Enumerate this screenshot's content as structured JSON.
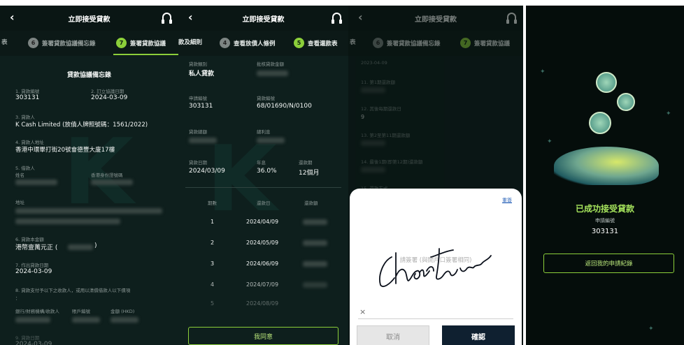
{
  "screen1": {
    "title": "立即接受貸款",
    "steps": [
      {
        "num": "",
        "label": "表"
      },
      {
        "num": "6",
        "label": "簽署貸款協議備忘錄"
      },
      {
        "num": "7",
        "label": "簽署貸款協議"
      }
    ],
    "heading": "貸款協議備忘錄",
    "f1_label": "1. 貸款編號",
    "f1_value": "303131",
    "f2_label": "2. 訂立協議日期",
    "f2_value": "2024-03-09",
    "f3_label": "3. 貸款人",
    "f3_value": "K Cash Limited (放債人牌照號碼：1561/2022)",
    "f4_label": "4. 貸款人地址",
    "f4_value": "香港中環畢打街20號會德豐大廈17樓",
    "f5_label": "5. 借款人",
    "f5_name": "姓名",
    "f5_id": "香港身份證號碼",
    "f5_addr": "地址",
    "f6_label": "6. 貸款本金額",
    "f6_value": "港幣壹萬元正 (",
    "f6_close": ")",
    "f7_label": "7. 作出貸款日期",
    "f7_value": "2024-03-09",
    "f8_label": "8. 貸款支付予以下之收款人，或用以清償借款人以下債項",
    "f8_colon": "：",
    "f8_cols": [
      "銀行/財務機構/收款人",
      "賬戶編號",
      "金額 (HKD)"
    ],
    "f9_label": "9. 貸款日期",
    "f9_value": "2024-03-09"
  },
  "screen2": {
    "title": "立即接受貸款",
    "steps": [
      {
        "num": "",
        "label": "款及細則"
      },
      {
        "num": "4",
        "label": "查看放債人條例"
      },
      {
        "num": "5",
        "label": "查看還款表"
      }
    ],
    "loan_type_label": "貸款類別",
    "loan_type": "私人貸款",
    "amount_label": "批核貸款金額",
    "app_no_label": "申請編號",
    "app_no": "303131",
    "loan_no_label": "貸款編號",
    "loan_no": "68/01690/N/0100",
    "total_label": "貸款總額",
    "interest_label": "總利息",
    "date_label": "貸款日期",
    "date": "2024/03/09",
    "rate_label": "年息",
    "rate": "36.0%",
    "term_label": "還款期",
    "term": "12個月",
    "table_headers": [
      "期數",
      "還款日",
      "還款額"
    ],
    "rows": [
      {
        "n": "1",
        "d": "2024/04/09"
      },
      {
        "n": "2",
        "d": "2024/05/09"
      },
      {
        "n": "3",
        "d": "2024/06/09"
      },
      {
        "n": "4",
        "d": "2024/07/09"
      },
      {
        "n": "5",
        "d": "2024/08/09"
      }
    ],
    "agree": "我同意"
  },
  "screen3": {
    "title": "立即接受貸款",
    "steps": [
      {
        "num": "",
        "label": "表"
      },
      {
        "num": "6",
        "label": "簽署貸款協議備忘錄"
      },
      {
        "num": "7",
        "label": "簽署貸款協議"
      }
    ],
    "bg_date": "2023-04-09",
    "bg_items": [
      "11. 第1期還款額",
      "12. 其後每期還款日",
      "13. 第2至第11期還款額",
      "14. 最後1期(即第12期)還款額",
      "15. 還款方式"
    ],
    "bg_val": "9",
    "clear": "重簽",
    "sig_hint": "請簽署 (與開戶口簽署相同)",
    "x_mark": "×",
    "cancel": "取消",
    "confirm": "確認"
  },
  "screen4": {
    "success": "已成功接受貸款",
    "app_no_label": "申請編號",
    "app_no": "303131",
    "back_btn": "返回我的申請紀錄"
  }
}
